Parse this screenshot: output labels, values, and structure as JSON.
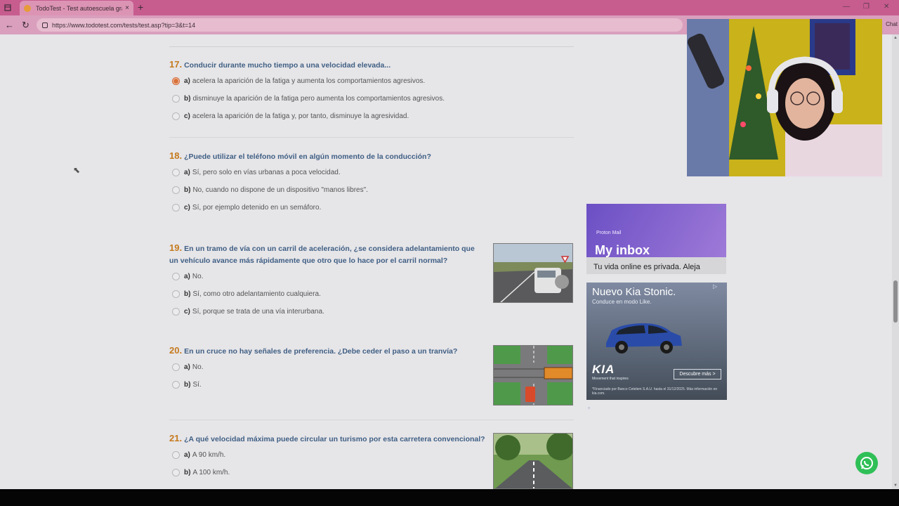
{
  "browser": {
    "tab_title": "TodoTest - Test autoescuela gratis",
    "tab_close": "×",
    "new_tab": "+",
    "url": "https://www.todotest.com/tests/test.asp?tip=3&t=14",
    "chat_label": "Chat"
  },
  "questions": [
    {
      "number": "17.",
      "text": "Conducir durante mucho tiempo a una velocidad elevada...",
      "options": [
        {
          "letter": "a)",
          "text": "acelera la aparición de la fatiga y aumenta los comportamientos agresivos.",
          "selected": true
        },
        {
          "letter": "b)",
          "text": "disminuye la aparición de la fatiga pero aumenta los comportamientos agresivos.",
          "selected": false
        },
        {
          "letter": "c)",
          "text": "acelera la aparición de la fatiga y, por tanto, disminuye la agresividad.",
          "selected": false
        }
      ]
    },
    {
      "number": "18.",
      "text": "¿Puede utilizar el teléfono móvil en algún momento de la conducción?",
      "options": [
        {
          "letter": "a)",
          "text": "Sí, pero solo en vías urbanas a poca velocidad.",
          "selected": false
        },
        {
          "letter": "b)",
          "text": "No, cuando no dispone de un dispositivo \"manos libres\".",
          "selected": false
        },
        {
          "letter": "c)",
          "text": "Sí, por ejemplo detenido en un semáforo.",
          "selected": false
        }
      ]
    },
    {
      "number": "19.",
      "text": "En un tramo de vía con un carril de aceleración, ¿se considera adelantamiento que un vehículo avance más rápidamente que otro que lo hace por el carril normal?",
      "options": [
        {
          "letter": "a)",
          "text": "No.",
          "selected": false
        },
        {
          "letter": "b)",
          "text": "Sí, como otro adelantamiento cualquiera.",
          "selected": false
        },
        {
          "letter": "c)",
          "text": "Sí, porque se trata de una vía interurbana.",
          "selected": false
        }
      ]
    },
    {
      "number": "20.",
      "text": "En un cruce no hay señales de preferencia. ¿Debe ceder el paso a un tranvía?",
      "options": [
        {
          "letter": "a)",
          "text": "No.",
          "selected": false
        },
        {
          "letter": "b)",
          "text": "Sí.",
          "selected": false
        }
      ]
    },
    {
      "number": "21.",
      "text": "¿A qué velocidad máxima puede circular un turismo por esta carretera convencional?",
      "options": [
        {
          "letter": "a)",
          "text": "A 90 km/h.",
          "selected": false
        },
        {
          "letter": "b)",
          "text": "A 100 km/h.",
          "selected": false
        }
      ]
    }
  ],
  "ads": {
    "proton": {
      "brand": "Proton Mail",
      "headline": "My inbox",
      "tagline": "Tu vida online es privada. Aleja"
    },
    "kia": {
      "headline": "Nuevo Kia Stonic.",
      "subline": "Conduce en modo Like.",
      "logo": "KIA",
      "motto": "Movement that inspires",
      "cta": "Descubre más  >",
      "fine_print": "*Financiado por Banco Cetelem S.A.U. hasta el 31/12/2025. Más información en kia.com."
    }
  },
  "colors": {
    "tabbar": "#c75c8f",
    "question_text": "#3f5f84",
    "question_number": "#c57a1e",
    "selected_radio": "#d9713a",
    "whatsapp": "#2fbf57"
  }
}
